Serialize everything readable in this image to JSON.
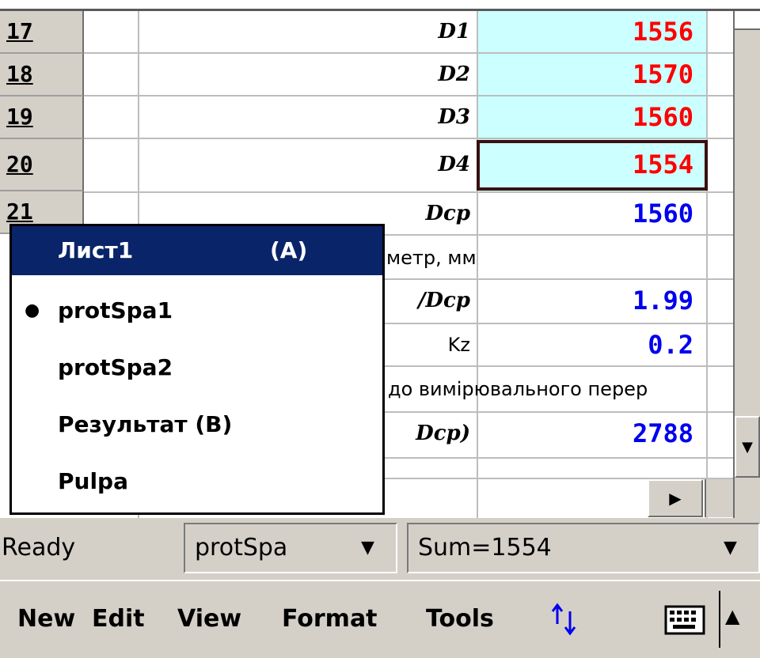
{
  "rows": [
    {
      "num": "17",
      "label": "D1",
      "value": "1556",
      "value_color": "#ff0000"
    },
    {
      "num": "18",
      "label": "D2",
      "value": "1570",
      "value_color": "#ff0000"
    },
    {
      "num": "19",
      "label": "D3",
      "value": "1560",
      "value_color": "#ff0000"
    },
    {
      "num": "20",
      "label": "D4",
      "value": "1554",
      "value_color": "#ff0000"
    },
    {
      "num": "21",
      "label": "Dcp",
      "value": "1560",
      "value_color": "#0000ee"
    }
  ],
  "hidden_rows": {
    "r22_text": "метр, мм",
    "r23_label": "/Dcp",
    "r23_value": "1.99",
    "r24_label": "Kz",
    "r24_value": "0.2",
    "r25_text": "до вимірювального перер",
    "r26_label": "Dcp)",
    "r26_value": "2788"
  },
  "sheet_menu": {
    "header": "Лист1",
    "header_shortcut": "(A)",
    "items": [
      {
        "label": "protSpa1",
        "selected": true
      },
      {
        "label": "protSpa2",
        "selected": false
      },
      {
        "label": "Результат (B)",
        "selected": false
      },
      {
        "label": "Pulpa",
        "selected": false
      }
    ]
  },
  "status_bar": {
    "state": "Ready",
    "sheet_dropdown": "protSpa",
    "sum": "Sum=1554"
  },
  "command_bar": {
    "menus": [
      "New",
      "Edit",
      "View",
      "Format",
      "Tools"
    ],
    "sort_icon": "sort-arrows-icon",
    "keyboard_icon": "keyboard-icon"
  },
  "colors": {
    "selection": "#0a246a",
    "cell_highlight": "#ccffff",
    "red_value": "#ff0000",
    "blue_value": "#0000ee",
    "chrome": "#d4d0c8"
  }
}
